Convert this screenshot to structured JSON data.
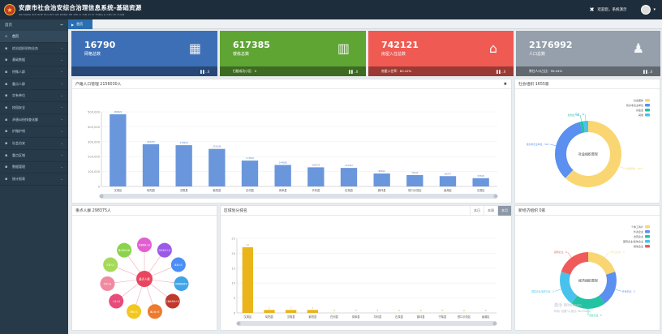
{
  "app": {
    "title": "安康市社会治安综合治理信息系统-基础资源",
    "subtitle": "AN KANG SHI SHE HUI ZHI AN ZONG HE ZHI LI XIN XI XI TONG JI CHU ZI YUAN",
    "logo_glyph": "★",
    "welcome": "欢迎您，系统演示",
    "close_glyph": "✖",
    "caret": "▾"
  },
  "sidebar": {
    "header": "首页",
    "toggle": "⇐",
    "items": [
      {
        "icon": "⌂",
        "label": "首页",
        "active": true
      },
      {
        "icon": "▪",
        "label": "综治组织机构业务"
      },
      {
        "icon": "▪",
        "label": "基础数据"
      },
      {
        "icon": "▪",
        "label": "特殊人群"
      },
      {
        "icon": "▪",
        "label": "重点人群"
      },
      {
        "icon": "▪",
        "label": "实有单位"
      },
      {
        "icon": "▪",
        "label": "校园安全"
      },
      {
        "icon": "▪",
        "label": "矛盾纠纷排查化解"
      },
      {
        "icon": "▪",
        "label": "护路护线"
      },
      {
        "icon": "▪",
        "label": "社会治安"
      },
      {
        "icon": "▪",
        "label": "重点区域"
      },
      {
        "icon": "▪",
        "label": "数据管理"
      },
      {
        "icon": "▪",
        "label": "统计报表"
      }
    ]
  },
  "tabs": [
    {
      "icon": "▶",
      "label": "首页"
    }
  ],
  "cards": [
    {
      "value": "16790",
      "label": "网格总数",
      "icon": "▦",
      "color": "#3d6fb6",
      "footer": "",
      "footer_right": "▌▌..ll"
    },
    {
      "value": "617385",
      "label": "楼栋总数",
      "icon": "▥",
      "color": "#5ea534",
      "footer": "扫楼成功小区：0",
      "footer_right": "▌▌..ll"
    },
    {
      "value": "742121",
      "label": "房屋入住总数",
      "icon": "⌂",
      "color": "#ef5a52",
      "footer": "房屋入住率：80.42%",
      "footer_right": "▌▌..ll"
    },
    {
      "value": "2176992",
      "label": "人口总数",
      "icon": "♟",
      "color": "#95a0ac",
      "footer": "常住人口占比：99.04%",
      "footer_right": "▌▌..ll"
    }
  ],
  "panels": {
    "huji": {
      "title": "户籍人口管理 2156030人",
      "close": "✖"
    },
    "shehui": {
      "title": "社会组织 1655家"
    },
    "zhongdian": {
      "title": "重点人群 298375人"
    },
    "quyu": {
      "title": "区域划分排名",
      "segments": [
        "本日",
        "本周",
        "本月"
      ],
      "active_segment": 2
    },
    "xinjingji": {
      "title": "新经济组织 0家"
    }
  },
  "watermark": {
    "line1": "激活 Windows",
    "line2": "转到\"设置\"以激活 Windows。"
  },
  "chart_data": [
    {
      "type": "bar",
      "id": "huji",
      "categories": [
        "汉滨区",
        "旬阳县",
        "汉阴县",
        "紫阳县",
        "白河县",
        "岚皋县",
        "平利县",
        "石泉县",
        "镇坪县",
        "宁陕县",
        "恒口示范区",
        "瀛湖生态旅游区"
      ],
      "tick_labels": [
        "汉滨区",
        "旬阳县",
        "汉阴县",
        "紫阳县",
        "白河县",
        "岚皋县",
        "平利县",
        "石泉县",
        "镇坪县",
        "恒口示范区",
        "瀛湖区",
        "汉滨区"
      ],
      "values": [
        483824,
        283475,
        276644,
        251638,
        173618,
        144088,
        128274,
        124322,
        86812,
        76440,
        69247,
        55528
      ],
      "ylim": [
        0,
        500000
      ],
      "yticks": [
        "0",
        "100,000",
        "200,000",
        "300,000",
        "400,000",
        "500,000"
      ],
      "color": "#6a96dc"
    },
    {
      "type": "pie",
      "id": "shehui",
      "center_label": "社会组织类型",
      "legend": [
        "社会团体",
        "民办非企业单位",
        "基金会",
        "其他"
      ],
      "values": [
        1027,
        561,
        28,
        39
      ],
      "colors": [
        "#f9d672",
        "#5b8ff0",
        "#22c3a2",
        "#48c2ec"
      ],
      "slice_labels": [
        "社会团体：1027",
        "民办非企业单位：561",
        "基金会：28",
        "其他：39"
      ]
    },
    {
      "type": "graph",
      "id": "zhongdian",
      "center": "重点人群",
      "nodes": [
        "刑满释放人员",
        "社区矫正人员",
        "吸毒人员",
        "精神障碍患者",
        "艾滋病危险人员",
        "重点青少年",
        "邪教人员",
        "上访人员",
        "涉稳人员",
        "在逃人员",
        "重点帮扶对象"
      ],
      "colors": [
        "#e25fd0",
        "#9b59e8",
        "#4b8ef5",
        "#3fa4e8",
        "#c0392b",
        "#ee7a2d",
        "#f2c81e",
        "#e74c7a",
        "#f08aa0",
        "#a5d95b",
        "#8bd34c"
      ]
    },
    {
      "type": "bar",
      "id": "quyu",
      "categories": [
        "汉滨区",
        "旬阳县",
        "汉阴县",
        "紫阳县",
        "白河县",
        "岚皋县",
        "平利县",
        "石泉县",
        "镇坪县",
        "宁陕县",
        "恒口示范区",
        "瀛湖区"
      ],
      "values": [
        22,
        1,
        1,
        1,
        0,
        0,
        0,
        0,
        0,
        0,
        0,
        0
      ],
      "ylim": [
        0,
        25
      ],
      "yticks": [
        "0",
        "5",
        "10",
        "15",
        "20",
        "25"
      ],
      "color": "#e9b51b"
    },
    {
      "type": "pie",
      "id": "xinjingji",
      "center_label": "经济组织类型",
      "legend": [
        "个体工商户",
        "外资企业",
        "合营企业",
        "国营企业/集体企业",
        "其他企业"
      ],
      "values": [
        20,
        20,
        20,
        20,
        20
      ],
      "colors": [
        "#f9d672",
        "#5b8ff0",
        "#22c3a2",
        "#48c2ec",
        "#f05a5a"
      ],
      "slice_labels": [
        "个体工商户：0",
        "外资企业：0",
        "合营企业：0",
        "国营企业/集体企业：0",
        "其他企业：0"
      ]
    }
  ]
}
